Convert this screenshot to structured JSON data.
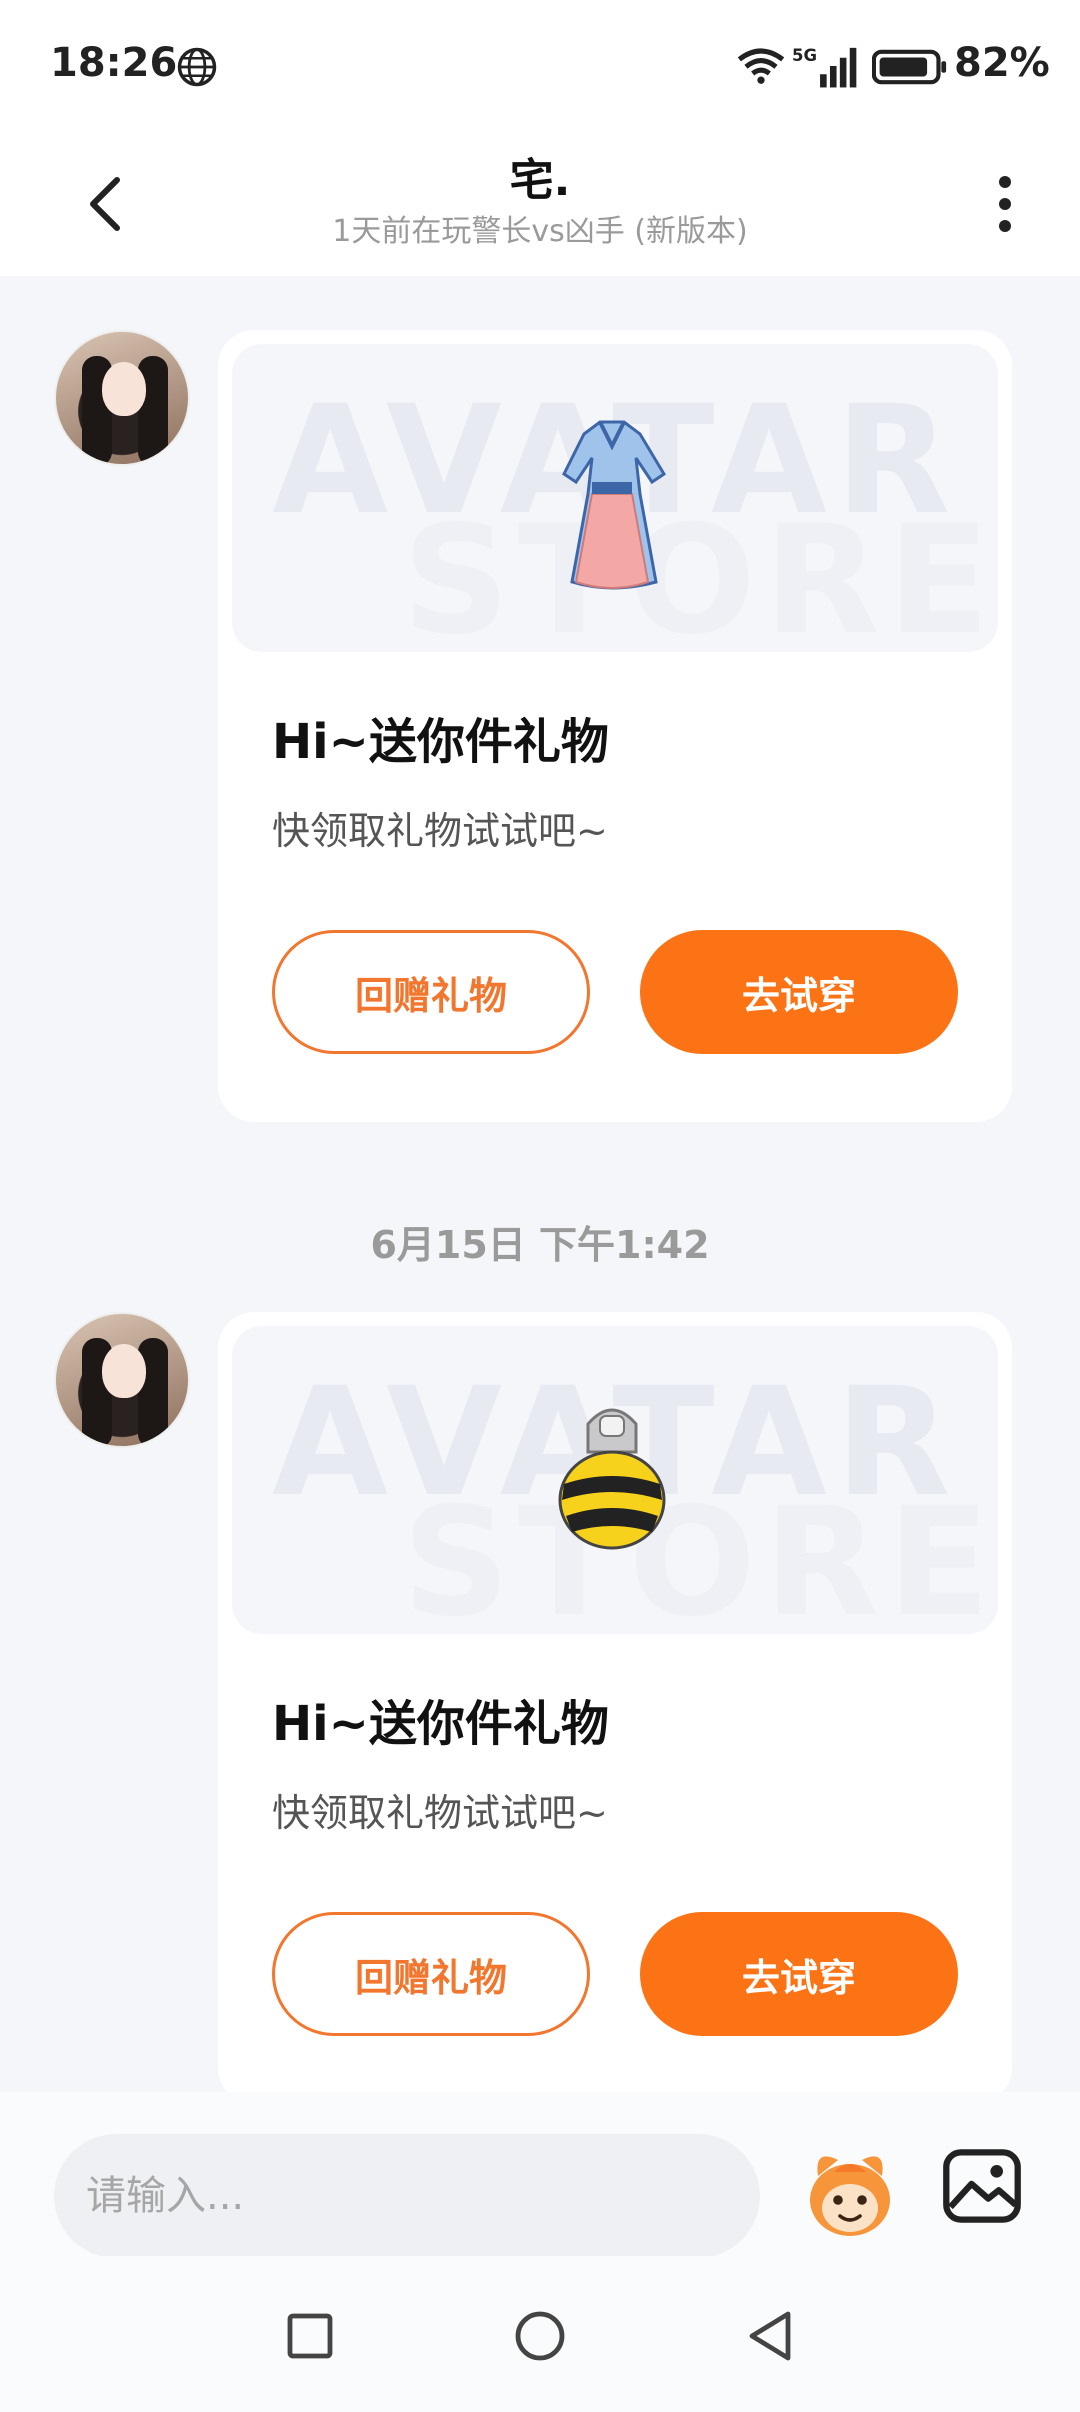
{
  "status_bar": {
    "time": "18:26",
    "battery_percent": "82%",
    "network_type": "5G",
    "icons": [
      "globe-icon",
      "wifi-icon",
      "signal-icon",
      "battery-icon"
    ]
  },
  "header": {
    "title": "宅.",
    "subtitle": "1天前在玩警长vs凶手 (新版本)",
    "icons": [
      "back-icon",
      "more-icon"
    ]
  },
  "messages": [
    {
      "type": "gift_card",
      "banner_watermark_1": "AVATAR",
      "banner_watermark_2": "STORE",
      "item_icon": "hanfu-dress-icon",
      "title": "Hi~送你件礼物",
      "description": "快领取礼物试试吧~",
      "return_gift_label": "回赠礼物",
      "try_on_label": "去试穿"
    },
    {
      "type": "gift_card",
      "banner_watermark_1": "AVATAR",
      "banner_watermark_2": "STORE",
      "item_icon": "bee-helmet-icon",
      "title": "Hi~送你件礼物",
      "description": "快领取礼物试试吧~",
      "return_gift_label": "回赠礼物",
      "try_on_label": "去试穿"
    }
  ],
  "timestamp": "6月15日 下午1:42",
  "input_bar": {
    "placeholder": "请输入...",
    "icons": [
      "sticker-icon",
      "image-icon"
    ]
  },
  "nav_bar": {
    "icons": [
      "recents-icon",
      "home-icon",
      "back-nav-icon"
    ]
  },
  "colors": {
    "accent": "#fb7314",
    "background": "#f4f6f9",
    "card": "#ffffff"
  }
}
